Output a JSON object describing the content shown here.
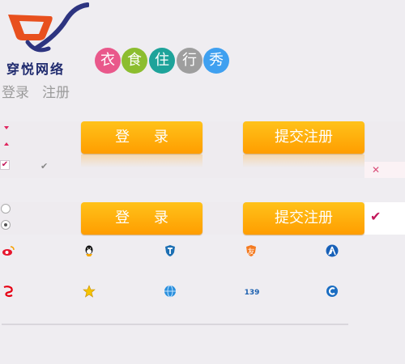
{
  "logo": {
    "text": "穿悦网络",
    "colors": {
      "cart": "#e8501e",
      "handle": "#2d3480"
    }
  },
  "slogan": {
    "chars": [
      {
        "char": "衣",
        "color": "#e9588b"
      },
      {
        "char": "食",
        "color": "#8cbd2f"
      },
      {
        "char": "住",
        "color": "#1ea39a"
      },
      {
        "char": "行",
        "color": "#9e9e9e"
      },
      {
        "char": "秀",
        "color": "#3fa0f0"
      }
    ]
  },
  "auth_links": {
    "login": "登录",
    "register": "注册"
  },
  "buttons": {
    "login_1": "登 录",
    "register_1": "提交注册",
    "login_2": "登 录",
    "register_2": "提交注册",
    "color_top": "#ffc21a",
    "color_bottom": "#ff9d00"
  },
  "marks": {
    "check": "✔",
    "close": "✕",
    "check_pink": "✔"
  },
  "social_icons": [
    "weibo-icon",
    "qq-icon",
    "shield-t-icon",
    "friend-icon",
    "renren-icon",
    "sohu-icon",
    "star-icon",
    "globe-icon",
    "mail139-icon",
    "telecom-icon"
  ],
  "accent": "#ff9d00"
}
